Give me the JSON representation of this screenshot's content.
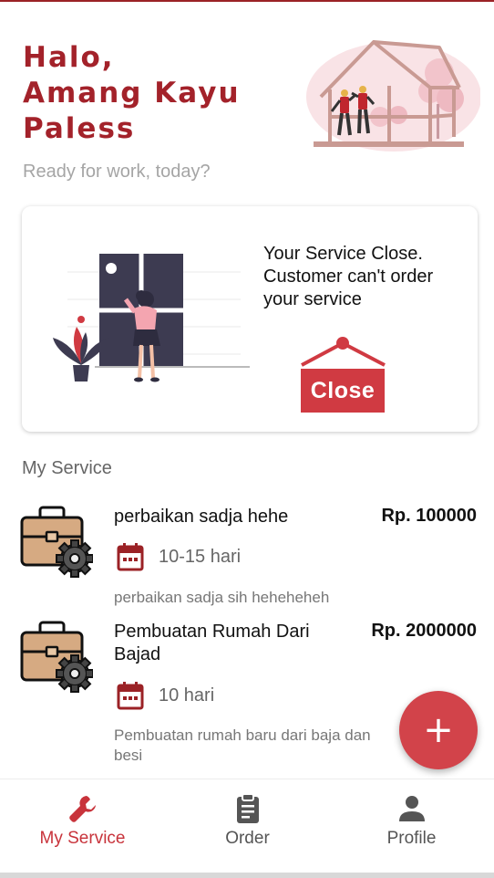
{
  "theme": {
    "accent": "#a3222a",
    "fab": "#d2434a",
    "close_red": "#d03a42"
  },
  "header": {
    "greeting_lines": [
      "Halo,",
      "Amang Kayu",
      "Paless"
    ],
    "subtitle": "Ready for work, today?",
    "illustration": "house-construction-illustration"
  },
  "status_card": {
    "message": "Your Service Close. Customer can't order your service",
    "badge_label": "Close",
    "illustration": "woman-at-window-illustration"
  },
  "my_service": {
    "title": "My Service",
    "items": [
      {
        "name": "perbaikan sadja hehe",
        "price": "Rp. 100000",
        "duration": "10-15 hari",
        "description": "perbaikan sadja sih heheheheh",
        "icon": "briefcase-gear-icon"
      },
      {
        "name": "Pembuatan Rumah Dari Bajad",
        "price": "Rp. 2000000",
        "duration": "10 hari",
        "description": "Pembuatan rumah baru dari baja dan besi",
        "icon": "briefcase-gear-icon"
      }
    ]
  },
  "fab": {
    "label": "+"
  },
  "bottom_nav": {
    "items": [
      {
        "label": "My Service",
        "icon": "wrench-icon",
        "active": true
      },
      {
        "label": "Order",
        "icon": "clipboard-icon",
        "active": false
      },
      {
        "label": "Profile",
        "icon": "person-icon",
        "active": false
      }
    ]
  }
}
